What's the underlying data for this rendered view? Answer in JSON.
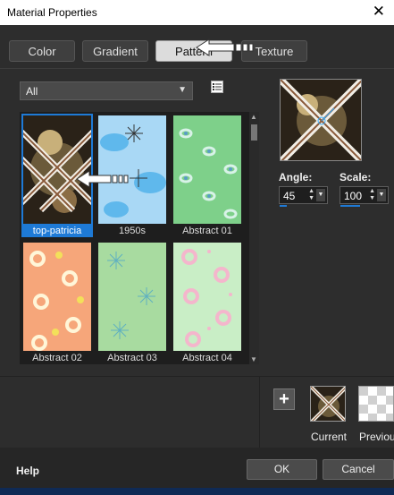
{
  "window": {
    "title": "Material Properties",
    "close_glyph": "✕"
  },
  "tabs": [
    {
      "label": "Color",
      "active": false
    },
    {
      "label": "Gradient",
      "active": false
    },
    {
      "label": "Pattern",
      "active": true
    },
    {
      "label": "Texture",
      "active": false
    }
  ],
  "category_dropdown": {
    "value": "All"
  },
  "patterns": [
    {
      "label": "top-patricia",
      "selected": true
    },
    {
      "label": "1950s",
      "selected": false
    },
    {
      "label": "Abstract 01",
      "selected": false
    },
    {
      "label": "Abstract 02",
      "selected": false
    },
    {
      "label": "Abstract 03",
      "selected": false
    },
    {
      "label": "Abstract 04",
      "selected": false
    }
  ],
  "angle": {
    "label": "Angle:",
    "value": "45"
  },
  "scale": {
    "label": "Scale:",
    "value": "100"
  },
  "swatches": {
    "current_label": "Current",
    "previous_label": "Previou"
  },
  "footer": {
    "help": "Help",
    "ok": "OK",
    "cancel": "Cancel"
  },
  "colors": {
    "accent": "#1e7ad6",
    "background": "#2d2d2d",
    "frame_brown": "#8a5a3a"
  },
  "icons": [
    "close-icon",
    "list-view-icon",
    "chevron-down-icon",
    "pointer-hand-icon",
    "plus-icon",
    "spin-arrows-icon"
  ]
}
